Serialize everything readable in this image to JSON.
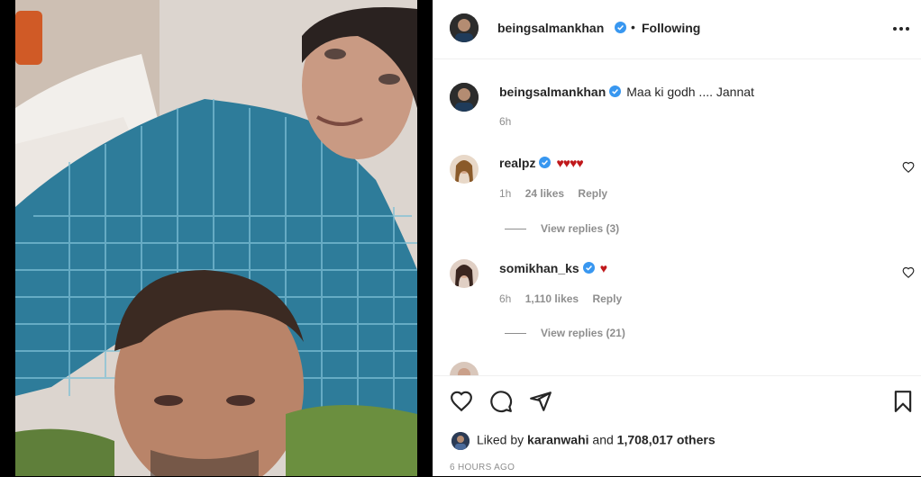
{
  "header": {
    "username": "beingsalmankhan",
    "separator": "•",
    "follow_status": "Following",
    "more_icon": "more-horizontal-icon"
  },
  "caption": {
    "username": "beingsalmankhan",
    "text": "Maa ki godh .... Jannat",
    "age": "6h"
  },
  "comments": [
    {
      "username": "realpz",
      "text": "♥♥♥♥",
      "age": "1h",
      "likes": "24 likes",
      "reply_label": "Reply",
      "view_replies": "View replies (3)"
    },
    {
      "username": "somikhan_ks",
      "text": "♥",
      "age": "6h",
      "likes": "1,110 likes",
      "reply_label": "Reply",
      "view_replies": "View replies (21)"
    }
  ],
  "actions": {
    "like_icon": "heart-icon",
    "comment_icon": "comment-icon",
    "share_icon": "paper-plane-icon",
    "save_icon": "bookmark-icon"
  },
  "likes": {
    "prefix": "Liked by",
    "user": "karanwahi",
    "connector": "and",
    "others": "1,708,017 others"
  },
  "posted": "6 HOURS AGO",
  "colors": {
    "verified": "#3897f0",
    "heart_red": "#c0181b",
    "muted_text": "#8e8e8e",
    "divider": "#efefef"
  }
}
